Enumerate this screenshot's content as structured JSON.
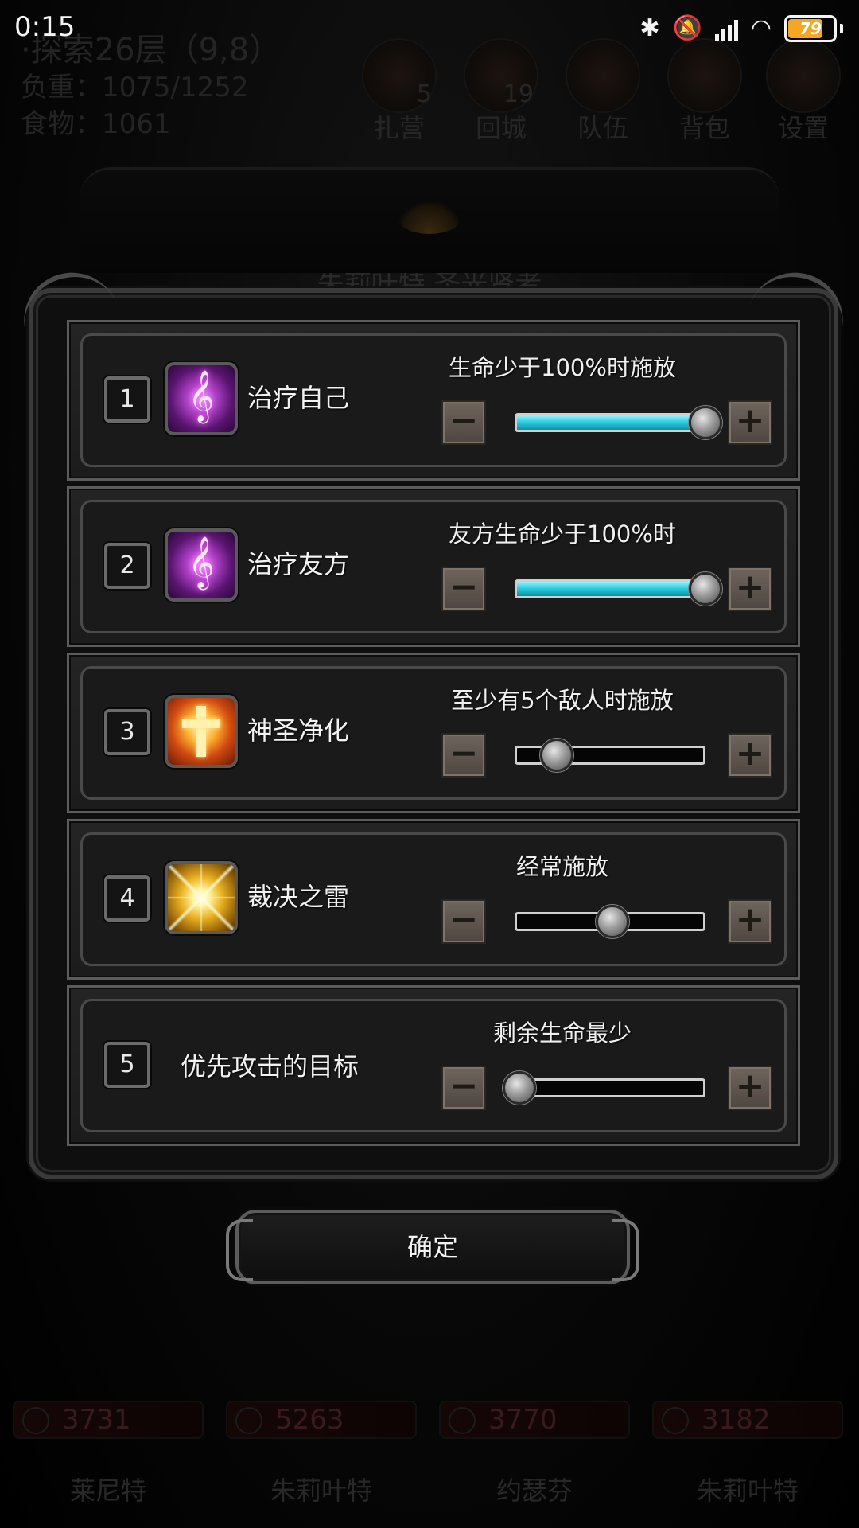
{
  "status_bar": {
    "time": "0:15",
    "battery_level": 79,
    "icons": [
      "bluetooth-icon",
      "mute-vibrate-icon",
      "signal-icon",
      "wifi-icon",
      "battery-icon"
    ]
  },
  "background": {
    "floor_text": "·探索26层（9,8）",
    "weight_text": "负重：1075/1252",
    "food_text": "食物：1061",
    "hud_buttons": [
      {
        "label": "扎营",
        "count": "5"
      },
      {
        "label": "回城",
        "count": "19"
      },
      {
        "label": "队伍",
        "count": ""
      },
      {
        "label": "背包",
        "count": ""
      },
      {
        "label": "设置",
        "count": ""
      }
    ],
    "panel_title": "朱莉叶特 圣光贤者",
    "party": [
      {
        "hp": "3731",
        "name": "莱尼特"
      },
      {
        "hp": "5263",
        "name": "朱莉叶特"
      },
      {
        "hp": "3770",
        "name": "约瑟芬"
      },
      {
        "hp": "3182",
        "name": "朱莉叶特"
      }
    ]
  },
  "skills": [
    {
      "index": "1",
      "name": "治疗自己",
      "icon": "heal-self-icon",
      "condition": "生命少于100%时施放",
      "slider_value": 1.0,
      "slider_fill": true
    },
    {
      "index": "2",
      "name": "治疗友方",
      "icon": "heal-ally-icon",
      "condition": "友方生命少于100%时",
      "slider_value": 1.0,
      "slider_fill": true
    },
    {
      "index": "3",
      "name": "神圣净化",
      "icon": "holy-purify-icon",
      "condition": "至少有5个敌人时施放",
      "slider_value": 0.2,
      "slider_fill": false
    },
    {
      "index": "4",
      "name": "裁决之雷",
      "icon": "judgement-thunder-icon",
      "condition": "经常施放",
      "slider_value": 0.5,
      "slider_fill": false
    },
    {
      "index": "5",
      "name": "优先攻击的目标",
      "icon": "",
      "condition": "剩余生命最少",
      "slider_value": 0.0,
      "slider_fill": false
    }
  ],
  "stepper": {
    "minus": "−",
    "plus": "+"
  },
  "confirm_label": "确定",
  "colors": {
    "slider_fill": "#28c8dc",
    "battery": "#f5a623",
    "frame": "#5c5c5c"
  }
}
